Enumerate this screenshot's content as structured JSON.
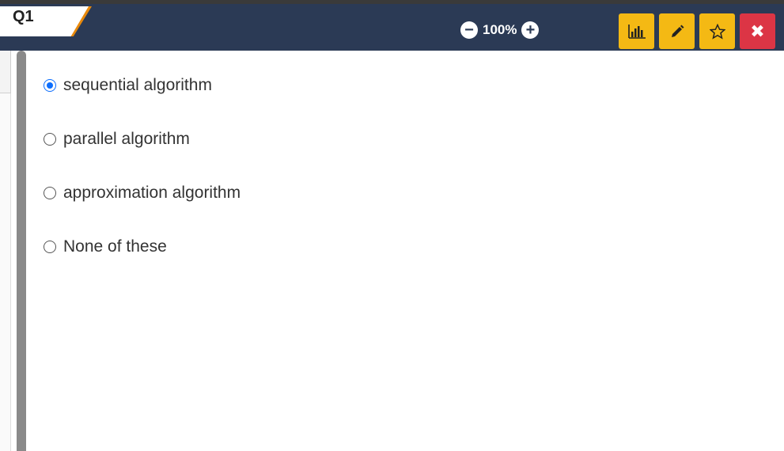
{
  "header": {
    "tab_label": "Q1",
    "zoom_level": "100%",
    "zoom_out_icon": "minus-circle-icon",
    "zoom_in_icon": "plus-circle-icon",
    "actions": [
      {
        "icon": "bar-chart-icon",
        "color": "#f4b914"
      },
      {
        "icon": "pencil-icon",
        "color": "#f4b914"
      },
      {
        "icon": "star-icon",
        "color": "#f4b914"
      },
      {
        "icon": "close-icon",
        "color": "#dc3545"
      }
    ]
  },
  "question": {
    "options": [
      {
        "label": "sequential algorithm",
        "selected": true
      },
      {
        "label": "parallel algorithm",
        "selected": false
      },
      {
        "label": "approximation algorithm",
        "selected": false
      },
      {
        "label": "None of these",
        "selected": false
      }
    ]
  }
}
